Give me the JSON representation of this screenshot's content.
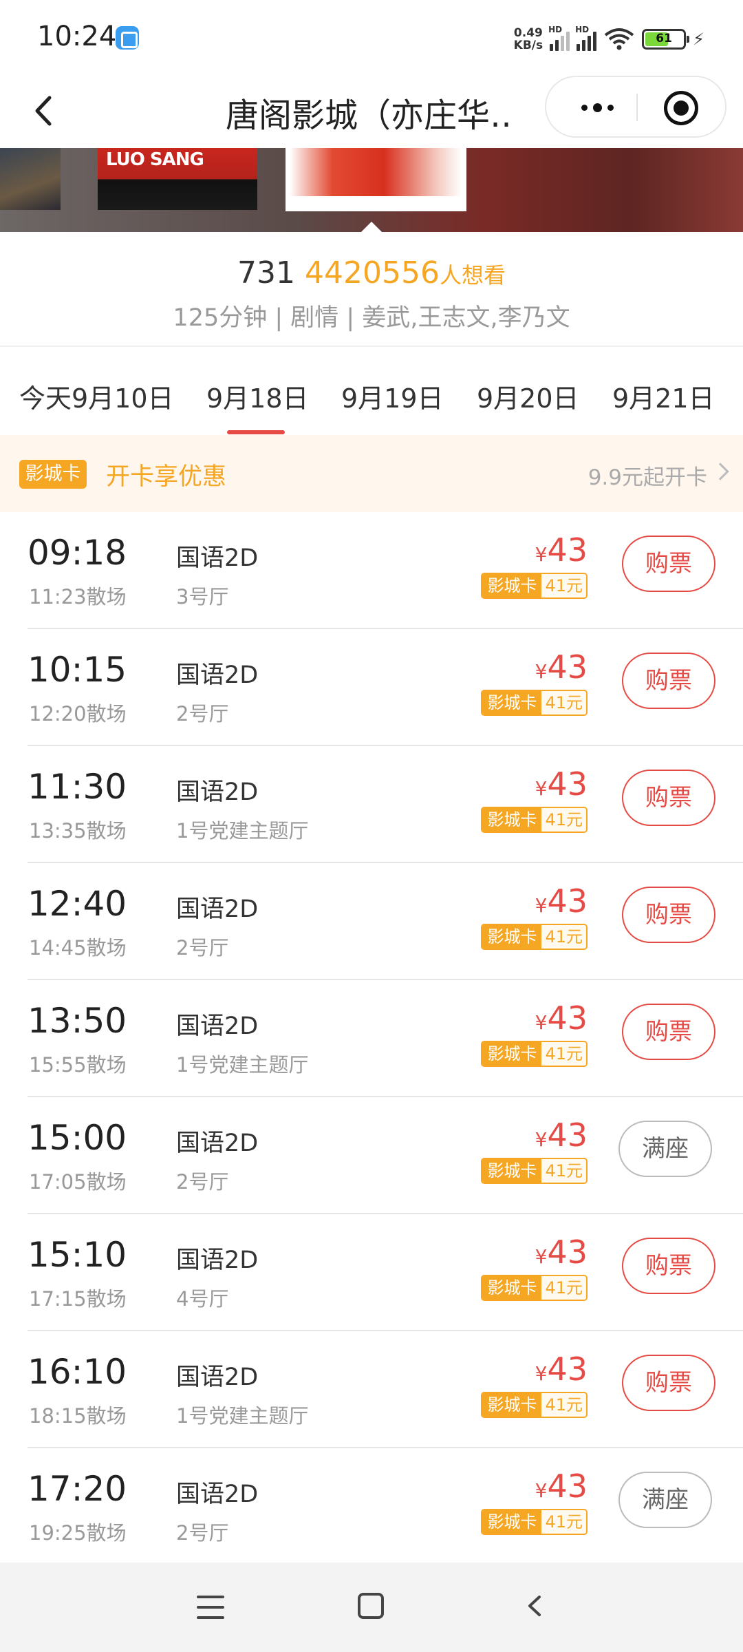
{
  "status_bar": {
    "time": "10:24",
    "net_speed_value": "0.49",
    "net_speed_unit": "KB/s",
    "signal_1_label": "HD",
    "signal_2_label": "HD",
    "battery_level": "61",
    "icons": [
      "app-notification-icon",
      "signal-icon",
      "signal-icon",
      "wifi-icon",
      "battery-icon",
      "charging-icon"
    ]
  },
  "nav": {
    "title": "唐阁影城（亦庄华…",
    "icons": [
      "back-icon",
      "more-icon",
      "close-icon"
    ]
  },
  "posters": {
    "poster_b_text": "LUO SANG"
  },
  "movie": {
    "score": "731",
    "want_count": "4420556",
    "want_label": "人想看",
    "meta": "125分钟 | 剧情 | 姜武,王志文,李乃文"
  },
  "dates": {
    "tabs": [
      "今天9月10日",
      "9月18日",
      "9月19日",
      "9月20日",
      "9月21日"
    ],
    "selected": "9月18日"
  },
  "promo": {
    "badge": "影城卡",
    "title": "开卡享优惠",
    "right_text": "9.9元起开卡"
  },
  "price_currency": "¥",
  "card_label": "影城卡",
  "showtimes": [
    {
      "start": "09:18",
      "end": "11:23散场",
      "lang": "国语2D",
      "hall": "3号厅",
      "price": "43",
      "card_price": "41元",
      "action": "购票"
    },
    {
      "start": "10:15",
      "end": "12:20散场",
      "lang": "国语2D",
      "hall": "2号厅",
      "price": "43",
      "card_price": "41元",
      "action": "购票"
    },
    {
      "start": "11:30",
      "end": "13:35散场",
      "lang": "国语2D",
      "hall": "1号党建主题厅",
      "price": "43",
      "card_price": "41元",
      "action": "购票"
    },
    {
      "start": "12:40",
      "end": "14:45散场",
      "lang": "国语2D",
      "hall": "2号厅",
      "price": "43",
      "card_price": "41元",
      "action": "购票"
    },
    {
      "start": "13:50",
      "end": "15:55散场",
      "lang": "国语2D",
      "hall": "1号党建主题厅",
      "price": "43",
      "card_price": "41元",
      "action": "购票"
    },
    {
      "start": "15:00",
      "end": "17:05散场",
      "lang": "国语2D",
      "hall": "2号厅",
      "price": "43",
      "card_price": "41元",
      "action": "满座"
    },
    {
      "start": "15:10",
      "end": "17:15散场",
      "lang": "国语2D",
      "hall": "4号厅",
      "price": "43",
      "card_price": "41元",
      "action": "购票"
    },
    {
      "start": "16:10",
      "end": "18:15散场",
      "lang": "国语2D",
      "hall": "1号党建主题厅",
      "price": "43",
      "card_price": "41元",
      "action": "购票"
    },
    {
      "start": "17:20",
      "end": "19:25散场",
      "lang": "国语2D",
      "hall": "2号厅",
      "price": "43",
      "card_price": "41元",
      "action": "满座"
    }
  ],
  "colors": {
    "accent_red": "#e54b44",
    "accent_orange": "#f5a623",
    "muted_text": "#999999"
  },
  "system_nav": {
    "icons": [
      "menu-icon",
      "home-icon",
      "back-nav-icon"
    ]
  }
}
